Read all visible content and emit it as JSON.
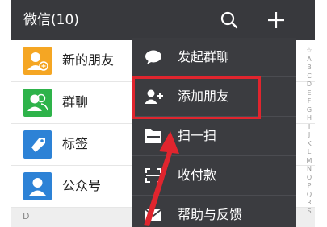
{
  "header": {
    "title": "微信(10)",
    "search_icon": "search-icon",
    "add_icon": "plus-icon",
    "bg_color": "#38393d"
  },
  "contacts": [
    {
      "label": "新的朋友",
      "icon": "add-friend-icon",
      "color": "#f5a623"
    },
    {
      "label": "群聊",
      "icon": "group-icon",
      "color": "#2eb34a"
    },
    {
      "label": "标签",
      "icon": "tag-icon",
      "color": "#2d82d6"
    },
    {
      "label": "公众号",
      "icon": "official-account-icon",
      "color": "#2d82d6"
    }
  ],
  "section_letter": "D",
  "index_letters": [
    "☆",
    "A",
    "B",
    "C",
    "D",
    "E",
    "F",
    "G",
    "H",
    "I",
    "J",
    "K",
    "L",
    "M",
    "N",
    "O",
    "P",
    "Q",
    "R",
    "S"
  ],
  "menu": {
    "bg_color": "#3b3c40",
    "items": [
      {
        "label": "发起群聊",
        "icon": "chat-bubble-icon"
      },
      {
        "label": "添加朋友",
        "icon": "add-user-icon"
      },
      {
        "label": "扫一扫",
        "icon": "scan-icon"
      },
      {
        "label": "收付款",
        "icon": "payment-scan-icon"
      },
      {
        "label": "帮助与反馈",
        "icon": "mail-icon"
      }
    ]
  },
  "annotation": {
    "highlight_color": "#e0252e",
    "arrow_color": "#e0252e"
  }
}
